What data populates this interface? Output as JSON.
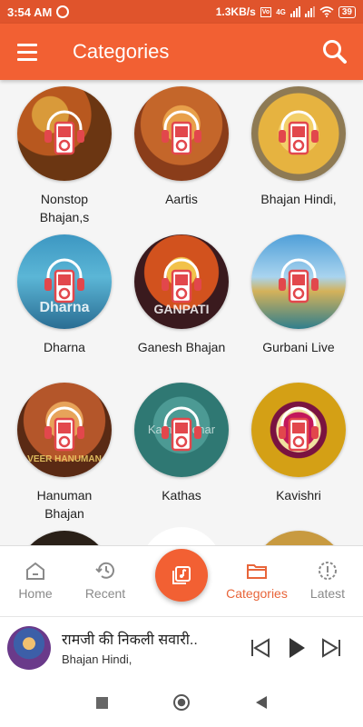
{
  "status_bar": {
    "time": "3:54 AM",
    "speed": "1.3KB/s",
    "network_tag": "4G",
    "battery": "39"
  },
  "app_bar": {
    "title": "Categories"
  },
  "categories": [
    {
      "label": "Nonstop\nBhajan,s"
    },
    {
      "label": "Aartis"
    },
    {
      "label": "Bhajan Hindi,"
    },
    {
      "label": "Dharna",
      "art_text": "Dharna"
    },
    {
      "label": "Ganesh Bhajan",
      "art_text": "GANPATI"
    },
    {
      "label": "Gurbani Live"
    },
    {
      "label": "Hanuman\nBhajan",
      "art_text": "VEER HANUMAN"
    },
    {
      "label": "Kathas",
      "art_text": "Katha Vichar"
    },
    {
      "label": "Kavishri"
    }
  ],
  "bottom_nav": {
    "home": "Home",
    "recent": "Recent",
    "categories": "Categories",
    "latest": "Latest"
  },
  "player": {
    "title": "रामजी की निकली सवारी..",
    "subtitle": "Bhajan Hindi,"
  },
  "colors": {
    "primary": "#f26033",
    "status": "#e0542c",
    "active": "#e8653a",
    "inactive": "#8a8a8a"
  }
}
